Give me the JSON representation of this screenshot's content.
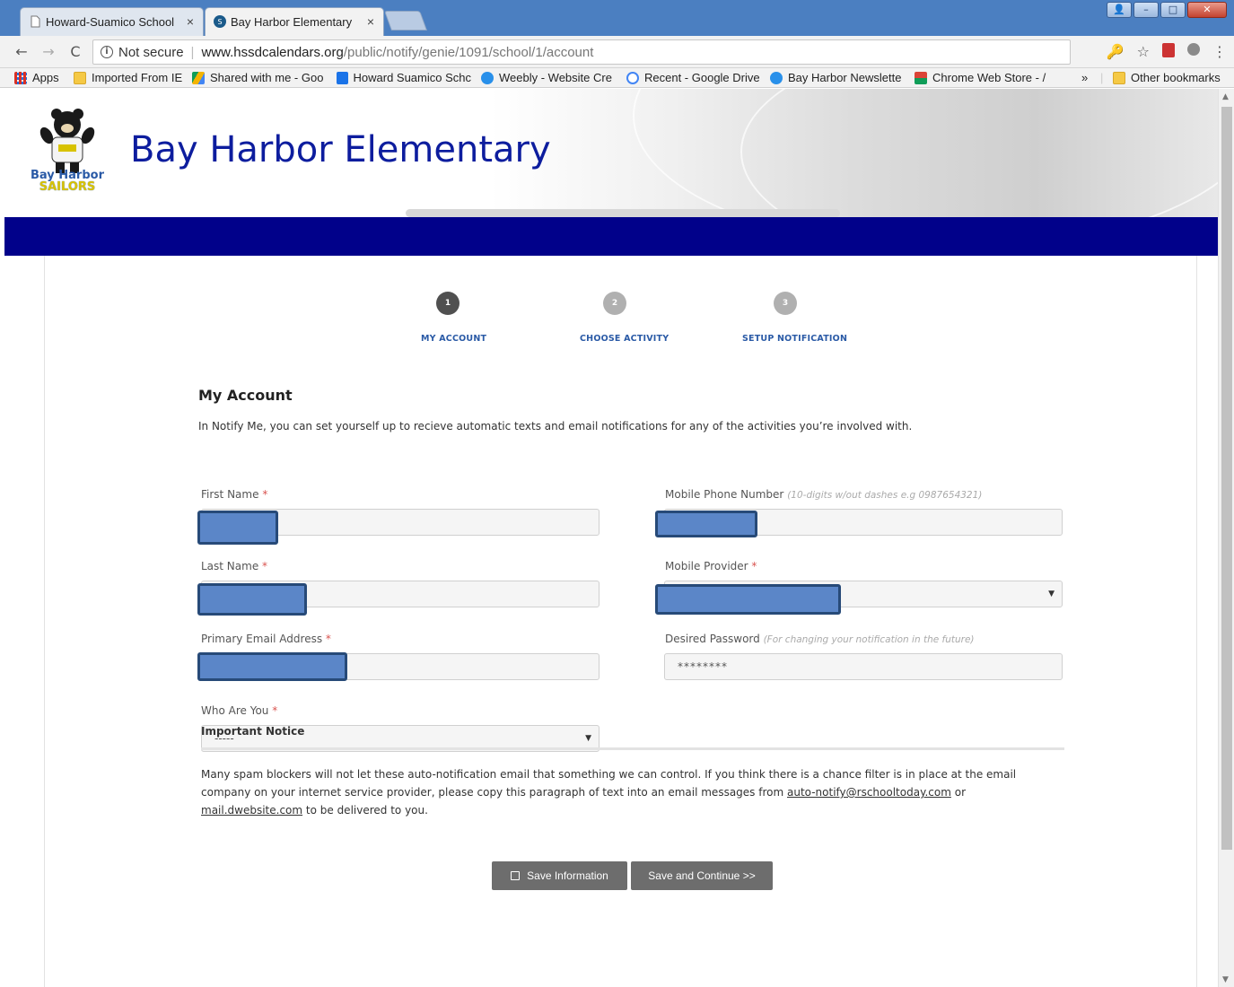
{
  "browser": {
    "tabs": [
      {
        "title": "Howard-Suamico School",
        "close": "×"
      },
      {
        "title": "Bay Harbor Elementary",
        "close": "×"
      }
    ],
    "window_buttons": {
      "user": "👤",
      "minimize": "–",
      "maximize": "□",
      "close": "✕"
    },
    "nav": {
      "back": "←",
      "forward": "→",
      "reload": "C"
    },
    "address": {
      "security_label": "Not secure",
      "host": "www.hssdcalendars.org",
      "path": "/public/notify/genie/1091/school/1/account"
    },
    "toolbar_icons": {
      "key": "🔑",
      "star": "☆",
      "menu": "⋮"
    },
    "bookmarks": [
      {
        "label": "Apps"
      },
      {
        "label": "Imported From IE"
      },
      {
        "label": "Shared with me - Goo"
      },
      {
        "label": "Howard Suamico Schc"
      },
      {
        "label": "Weebly - Website Cre"
      },
      {
        "label": "Recent - Google Drive"
      },
      {
        "label": "Bay Harbor Newslette"
      },
      {
        "label": "Chrome Web Store - /"
      }
    ],
    "bookmarks_overflow": "»",
    "other_bookmarks": "Other bookmarks"
  },
  "page": {
    "school_name": "Bay Harbor Elementary",
    "logo_text": {
      "line1": "Bay Harbor",
      "line2": "SAILORS"
    },
    "steps": [
      {
        "number": "1",
        "label": "MY ACCOUNT"
      },
      {
        "number": "2",
        "label": "CHOOSE ACTIVITY"
      },
      {
        "number": "3",
        "label": "SETUP NOTIFICATION"
      }
    ],
    "form": {
      "heading": "My Account",
      "intro": "In Notify Me, you can set yourself up to recieve automatic texts and email notifications for any of the activities you’re involved with.",
      "required_marker": "*",
      "first_name": {
        "label": "First Name",
        "value": ""
      },
      "last_name": {
        "label": "Last Name",
        "value": ""
      },
      "email": {
        "label": "Primary Email Address",
        "value": ""
      },
      "who_are_you": {
        "label": "Who Are You",
        "selected": "-----"
      },
      "mobile_phone": {
        "label": "Mobile Phone Number",
        "hint": "(10-digits w/out dashes e.g 0987654321)",
        "value": ""
      },
      "mobile_provider": {
        "label": "Mobile Provider",
        "selected": ""
      },
      "password": {
        "label": "Desired Password",
        "hint": "(For changing your notification in the future)",
        "value": "********"
      }
    },
    "notice": {
      "heading": "Important Notice",
      "text_part1": "Many spam blockers will not let these auto-notification email that something we can control. If you think there is a chance filter is in place at the email company on your internet service provider, please copy this paragraph of text into an email messages from ",
      "link1": "auto-notify@rschooltoday.com",
      "text_part2": " or ",
      "link2": "mail.dwebsite.com",
      "text_part3": " to be delivered to you."
    },
    "buttons": {
      "save": "Save Information",
      "save_continue": "Save and Continue >>"
    }
  },
  "colors": {
    "title_blue": "#0d1d9e",
    "navbar": "#01018a",
    "step_label": "#2a5aa6",
    "button": "#6d6d6d",
    "required": "#d9534f"
  }
}
